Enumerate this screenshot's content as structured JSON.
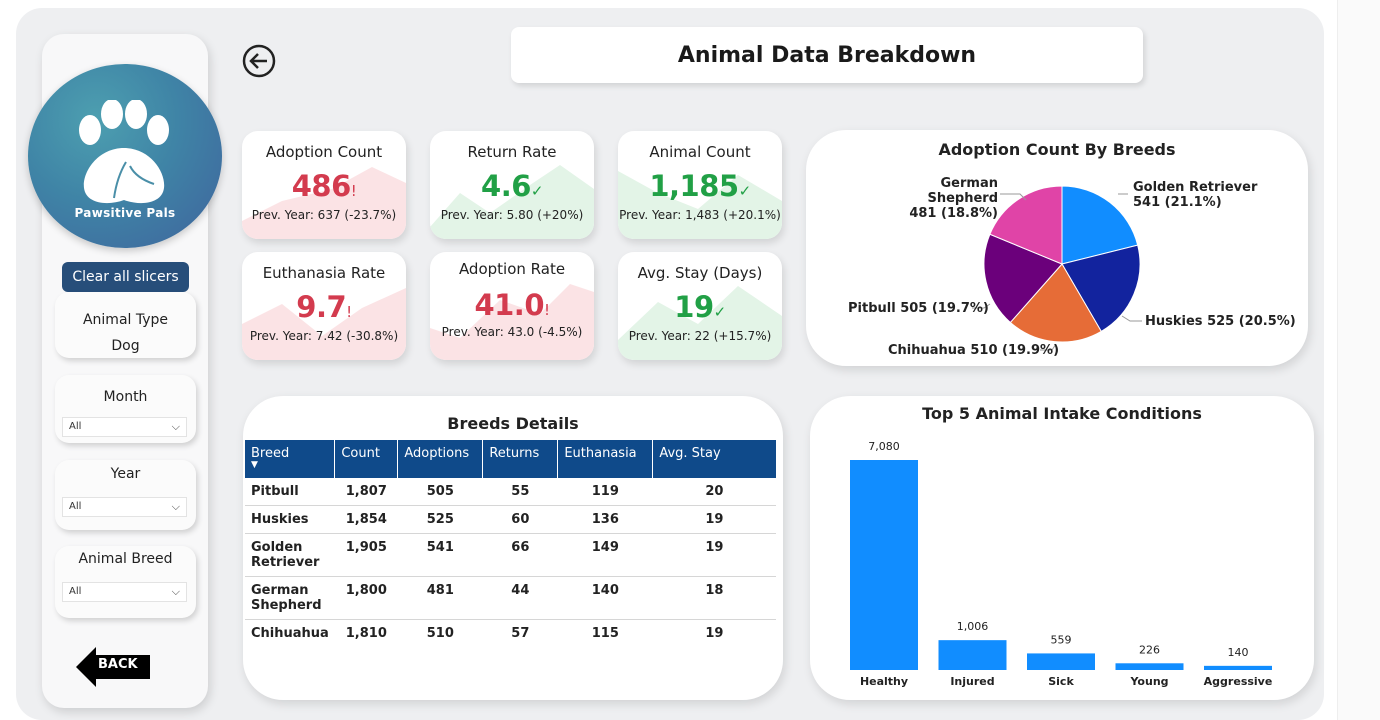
{
  "header": {
    "title": "Animal Data Breakdown"
  },
  "sidebar": {
    "logo_text": "Pawsitive Pals",
    "clear_label": "Clear all slicers",
    "animal_type": {
      "title": "Animal Type",
      "value": "Dog"
    },
    "month": {
      "title": "Month",
      "value": "All"
    },
    "year": {
      "title": "Year",
      "value": "All"
    },
    "animal_breed": {
      "title": "Animal Breed",
      "value": "All"
    },
    "back_label": "BACK"
  },
  "kpis": {
    "adoption_count": {
      "title": "Adoption Count",
      "value": "486",
      "mark": "!",
      "prev": "Prev. Year: 637",
      "delta": "(-23.7%)",
      "status": "bad"
    },
    "return_rate": {
      "title": "Return Rate",
      "value": "4.6",
      "mark": "✓",
      "prev": "Prev. Year: 5.80",
      "delta": "(+20%)",
      "status": "good"
    },
    "animal_count": {
      "title": "Animal Count",
      "value": "1,185",
      "mark": "✓",
      "prev": "Prev. Year: 1,483",
      "delta": "(+20.1%)",
      "status": "good"
    },
    "euthanasia_rate": {
      "title": "Euthanasia Rate",
      "value": "9.7",
      "mark": "!",
      "prev": "Prev. Year: 7.42",
      "delta": "(-30.8%)",
      "status": "bad"
    },
    "adoption_rate": {
      "title": "Adoption Rate",
      "value": "41.0",
      "mark": "!",
      "prev": "Prev. Year: 43.0",
      "delta": "(-4.5%)",
      "status": "bad"
    },
    "avg_stay": {
      "title": "Avg. Stay (Days)",
      "value": "19",
      "mark": "✓",
      "prev": "Prev. Year: 22",
      "delta": "(+15.7%)",
      "status": "good"
    }
  },
  "colors": {
    "bad": "#d33b4e",
    "good": "#21a046",
    "bad_fill": "#fbe3e5",
    "good_fill": "#e3f4e7",
    "header_blue": "#0f4a8a",
    "bar_blue": "#118dff"
  },
  "breeds_table": {
    "title": "Breeds Details",
    "columns": [
      "Breed",
      "Count",
      "Adoptions",
      "Returns",
      "Euthanasia",
      "Avg. Stay"
    ],
    "rows": [
      [
        "Pitbull",
        "1,807",
        "505",
        "55",
        "119",
        "20"
      ],
      [
        "Huskies",
        "1,854",
        "525",
        "60",
        "136",
        "19"
      ],
      [
        "Golden Retriever",
        "1,905",
        "541",
        "66",
        "149",
        "19"
      ],
      [
        "German Shepherd",
        "1,800",
        "481",
        "44",
        "140",
        "18"
      ],
      [
        "Chihuahua",
        "1,810",
        "510",
        "57",
        "115",
        "19"
      ]
    ]
  },
  "chart_data": [
    {
      "type": "pie",
      "title": "Adoption Count By Breeds",
      "categories": [
        "Golden Retriever",
        "Huskies",
        "Chihuahua",
        "Pitbull",
        "German Shepherd"
      ],
      "values": [
        541,
        525,
        510,
        505,
        481
      ],
      "labels": [
        "541 (21.1%)",
        "525 (20.5%)",
        "510 (19.9%)",
        "505 (19.7%)",
        "481 (18.8%)"
      ],
      "colors": [
        "#118dff",
        "#12239e",
        "#e66c37",
        "#6b007b",
        "#e044a7"
      ]
    },
    {
      "type": "bar",
      "title": "Top 5 Animal Intake Conditions",
      "categories": [
        "Healthy",
        "Injured",
        "Sick",
        "Young",
        "Aggressive"
      ],
      "values": [
        7080,
        1006,
        559,
        226,
        140
      ],
      "value_labels": [
        "7,080",
        "1,006",
        "559",
        "226",
        "140"
      ],
      "xlabel": "",
      "ylabel": "",
      "grid": false,
      "color": "#118dff"
    }
  ]
}
